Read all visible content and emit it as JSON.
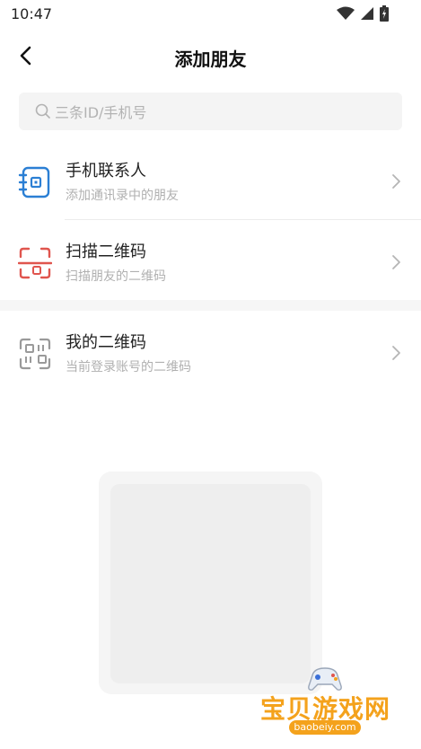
{
  "status": {
    "time": "10:47"
  },
  "nav": {
    "title": "添加朋友"
  },
  "search": {
    "placeholder": "三条ID/手机号"
  },
  "items": [
    {
      "title": "手机联系人",
      "subtitle": "添加通讯录中的朋友",
      "icon": "contacts-icon",
      "color": "#2b7fd4"
    },
    {
      "title": "扫描二维码",
      "subtitle": "扫描朋友的二维码",
      "icon": "scan-icon",
      "color": "#e0554e"
    },
    {
      "title": "我的二维码",
      "subtitle": "当前登录账号的二维码",
      "icon": "qr-code-icon",
      "color": "#9a9a9a"
    }
  ],
  "watermark": {
    "name": "宝贝游戏网",
    "url": "baobeiy.com"
  }
}
